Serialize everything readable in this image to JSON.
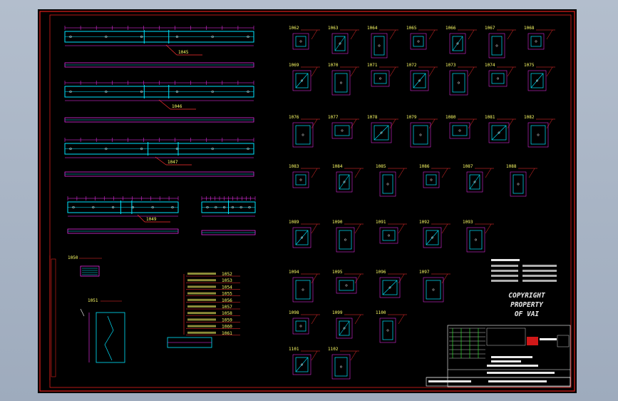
{
  "colors": {
    "background": "#000000",
    "border": "#e0201c",
    "beam": "#00e5ff",
    "dimension": "#ff33ff",
    "label": "#ffff66",
    "leader": "#ff3030",
    "text": "#e8e8e8"
  },
  "beam_elevations": [
    {
      "mark": "1045"
    },
    {
      "mark": "1046"
    },
    {
      "mark": "1047"
    },
    {
      "mark": "1049"
    }
  ],
  "part_details": {
    "rows": [
      [
        "1062",
        "1063",
        "1064",
        "1065",
        "1066",
        "1067",
        "1068"
      ],
      [
        "1069",
        "1070",
        "1071",
        "1072",
        "1073",
        "1074",
        "1075"
      ],
      [
        "1076",
        "1077",
        "1078",
        "1079",
        "1080",
        "1081",
        "1082"
      ],
      [
        "1083",
        "1084",
        "1085",
        "1086",
        "1087",
        "1088"
      ],
      [
        "1089",
        "1090",
        "1091",
        "1092",
        "1093"
      ],
      [
        "1094",
        "1095",
        "1096",
        "1097"
      ],
      [
        "1098",
        "1099",
        "1100"
      ],
      [
        "1101",
        "1102"
      ]
    ]
  },
  "small_details": [
    {
      "mark": "1050"
    },
    {
      "mark": "1051"
    }
  ],
  "schedule": {
    "marks": [
      "1052",
      "1053",
      "1054",
      "1055",
      "1056",
      "1057",
      "1058",
      "1059",
      "1060",
      "1061"
    ]
  },
  "watermark": {
    "line1": "COPYRIGHT",
    "line2": "PROPERTY",
    "line3": "OF VAI"
  }
}
